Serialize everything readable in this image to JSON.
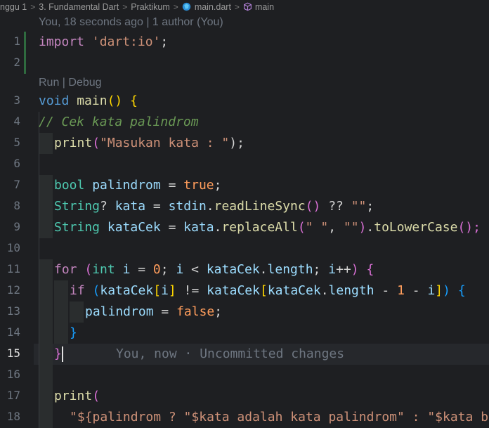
{
  "breadcrumb": {
    "items": [
      "nggu 1",
      "3. Fundamental Dart",
      "Praktikum",
      "main.dart",
      "main"
    ],
    "separator": ">"
  },
  "codelens": {
    "blame_header": "You, 18 seconds ago | 1 author (You)",
    "run_debug": "Run | Debug"
  },
  "blame_inline": "You, now · Uncommitted changes",
  "line_numbers": [
    "1",
    "2",
    "3",
    "4",
    "5",
    "6",
    "7",
    "8",
    "9",
    "10",
    "11",
    "12",
    "13",
    "14",
    "15",
    "16",
    "17",
    "18"
  ],
  "active_line": "15",
  "lines": {
    "l1": [
      "import",
      " ",
      "'dart:io'",
      ";"
    ],
    "l3": [
      "void",
      " ",
      "main",
      "()",
      " ",
      "{"
    ],
    "l4": "// Cek kata palindrom",
    "l5": [
      "print",
      "(",
      "\"Masukan kata : \"",
      ");"
    ],
    "l7": [
      "bool",
      " ",
      "palindrom",
      " = ",
      "true",
      ";"
    ],
    "l8": [
      "String",
      "? ",
      "kata",
      " = ",
      "stdin",
      ".",
      "readLineSync",
      "()",
      " ?? ",
      "\"\"",
      ";"
    ],
    "l9": [
      "String",
      " ",
      "kataCek",
      " = ",
      "kata",
      ".",
      "replaceAll",
      "(",
      "\" \"",
      ", ",
      "\"\"",
      ")",
      ".",
      "toLowerCase",
      "();"
    ],
    "l11": [
      "for",
      " ",
      "(",
      "int",
      " ",
      "i",
      " = ",
      "0",
      "; ",
      "i",
      " < ",
      "kataCek",
      ".",
      "length",
      "; ",
      "i",
      "++",
      ")",
      " ",
      "{"
    ],
    "l12": [
      "if",
      " ",
      "(",
      "kataCek",
      "[",
      "i",
      "]",
      " != ",
      "kataCek",
      "[",
      "kataCek",
      ".",
      "length",
      " - ",
      "1",
      " - ",
      "i",
      "]",
      ")",
      " ",
      "{"
    ],
    "l13": [
      "palindrom",
      " = ",
      "false",
      ";"
    ],
    "l14": "}",
    "l15": "}",
    "l17": [
      "print",
      "("
    ],
    "l18": [
      "\"${palindrom ? \"$kata adalah kata palindrom\" : \"$kata b"
    ]
  },
  "colors": {
    "background": "#1e1f22",
    "keyword": "#569cd6",
    "control": "#c586c0",
    "string": "#ce9178",
    "function": "#dcdcaa",
    "type": "#4ec9b0",
    "variable": "#9cdcfe",
    "number": "#b5cea8",
    "comment": "#6a9955"
  }
}
